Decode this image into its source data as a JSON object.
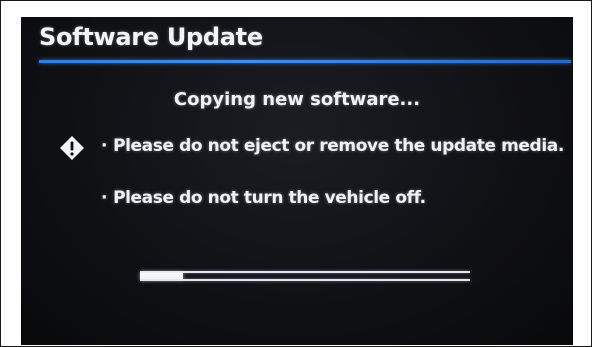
{
  "screen": {
    "title": "Software Update",
    "status": "Copying new software...",
    "warning_icon": "warning-diamond-icon",
    "messages": [
      {
        "bullet": "·",
        "text": "Please do not eject or remove the update media."
      },
      {
        "bullet": "·",
        "text": "Please do not turn the vehicle off."
      }
    ],
    "progress": {
      "fraction": 0.13
    }
  },
  "colors": {
    "accent": "#3a8aee",
    "background": "#0f1014",
    "text": "#eef1f6"
  }
}
